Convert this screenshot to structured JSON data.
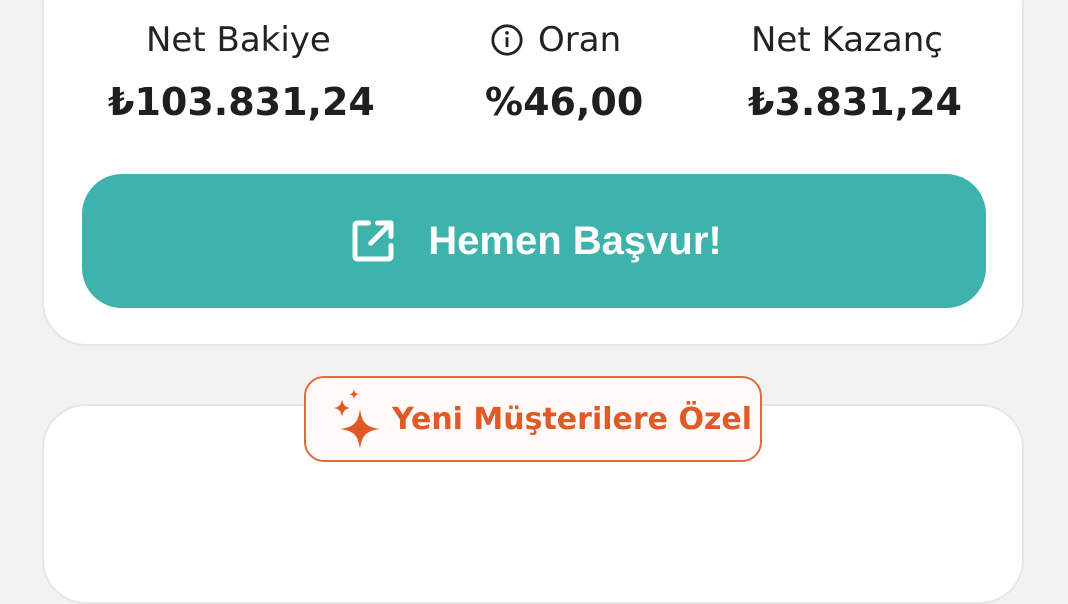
{
  "stats": [
    {
      "label": "Net Bakiye",
      "value": "₺103.831,24"
    },
    {
      "label": "Oran",
      "value": "%46,00",
      "icon": "info-icon"
    },
    {
      "label": "Net Kazanç",
      "value": "₺3.831,24"
    }
  ],
  "apply_button": {
    "label": "Hemen Başvur!",
    "icon": "external-link-icon"
  },
  "promo_badge": {
    "label": "Yeni Müşterilere Özel",
    "icon": "sparkle-icon"
  },
  "colors": {
    "accent": "#3db3ac",
    "promo": "#e05a27",
    "background": "#f2f2f2",
    "card": "#ffffff"
  }
}
